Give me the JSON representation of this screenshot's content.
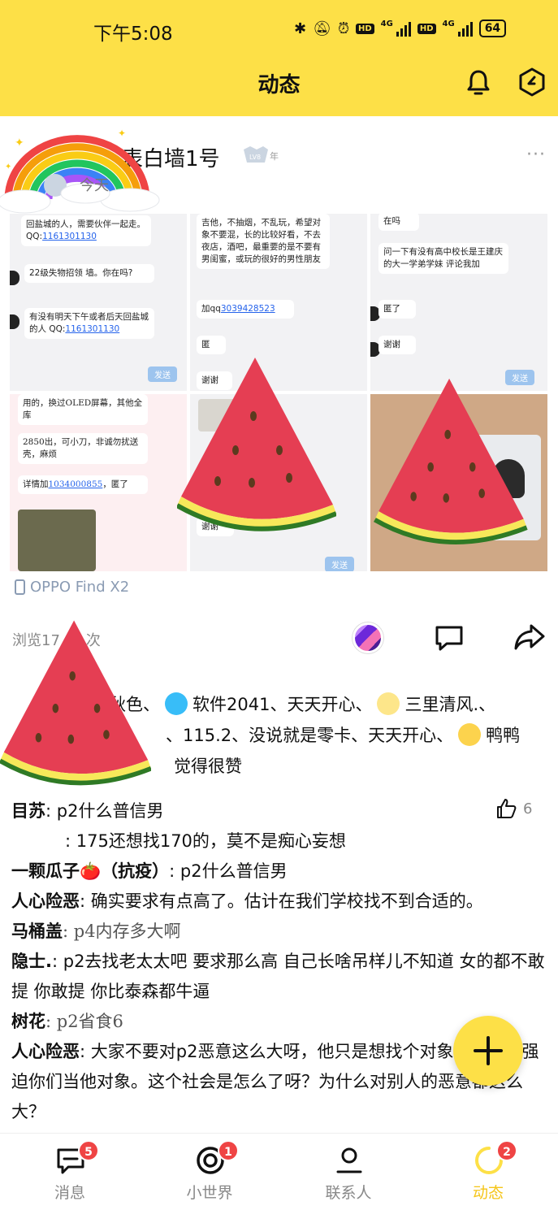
{
  "status_bar": {
    "time": "下午5:08",
    "net_1": "4G",
    "net_2": "4G",
    "hd": "HD",
    "battery": "64"
  },
  "header": {
    "title": "动态"
  },
  "post": {
    "author": "表白墙1号",
    "time": "今天",
    "level_badge": "LV8",
    "more": "···",
    "images": [
      {
        "messages": [
          "回盐城的人，需要伙伴一起走。 QQ:",
          "1161301130",
          "22级失物招领 墙。你在吗?",
          "有没有明天下午或者后天回盐城的人 QQ:",
          "1161301130"
        ],
        "send": "发送"
      },
      {
        "messages": [
          "吉他，不抽烟，不乱玩，希望对象不要混，长的比较好看，不去夜店，酒吧，最重要的是不要有男闺蜜，或玩的很好的男性朋友",
          "加qq",
          "3039428523",
          "匿",
          "谢谢"
        ],
        "send": ""
      },
      {
        "messages": [
          "在吗",
          "问一下有没有高中校长是王建庆的大一学弟学妹 评论我加",
          "匿了",
          "谢谢"
        ],
        "send": "发送"
      },
      {
        "messages": [
          "用的，换过OLED屏幕，其他全库",
          "2850出，可小刀，非诚勿扰送壳，麻烦",
          "详情加",
          "1034000855",
          "，匿了"
        ],
        "send": ""
      },
      {
        "messages": [
          "谢谢"
        ],
        "send": "发送"
      },
      {
        "messages": [],
        "send": ""
      }
    ],
    "device": "OPPO Find X2",
    "views": "浏览17",
    "views_suffix": "次"
  },
  "likes": {
    "line1": [
      "秋色、",
      "软件2041、天天开心、",
      "三里清风.、"
    ],
    "line2": [
      "、115.2、没说就是零卡、天天开心、",
      "鸭鸭"
    ],
    "line3": "觉得很赞"
  },
  "comments": [
    {
      "name": "目苏",
      "text": ": p2什么普信男",
      "likes": "6"
    },
    {
      "name": "",
      "text": ": 175还想找170的，莫不是痴心妄想"
    },
    {
      "name": "一颗瓜子🍅（抗疫）",
      "text": ": p2什么普信男"
    },
    {
      "name": "人心险恶",
      "text": ": 确实要求有点高了。估计在我们学校找不到合适的。"
    },
    {
      "name": "马桶盖",
      "text": ": p4内存多大啊"
    },
    {
      "name": "隐士.",
      "text": ": p2去找老太太吧 要求那么高 自己长啥吊样儿不知道 女的都不敢提 你敢提 你比泰森都牛逼"
    },
    {
      "name": "树花",
      "text": ": p2省食6"
    },
    {
      "name": "人心险恶",
      "text": ": 大家不要对p2恶意这么大呀，他只是想找个对象，又没有强迫你们当他对象。这个社会是怎么了呀？为什么对别人的恶意都这么大？"
    }
  ],
  "bottom_nav": [
    {
      "label": "消息",
      "badge": "5",
      "icon": "message-icon"
    },
    {
      "label": "小世界",
      "badge": "1",
      "icon": "world-icon"
    },
    {
      "label": "联系人",
      "badge": "",
      "icon": "contacts-icon"
    },
    {
      "label": "动态",
      "badge": "2",
      "icon": "feed-icon",
      "active": true
    }
  ],
  "colors": {
    "brand_yellow": "#fde047",
    "badge_red": "#ef4444",
    "link_blue": "#2563eb"
  }
}
